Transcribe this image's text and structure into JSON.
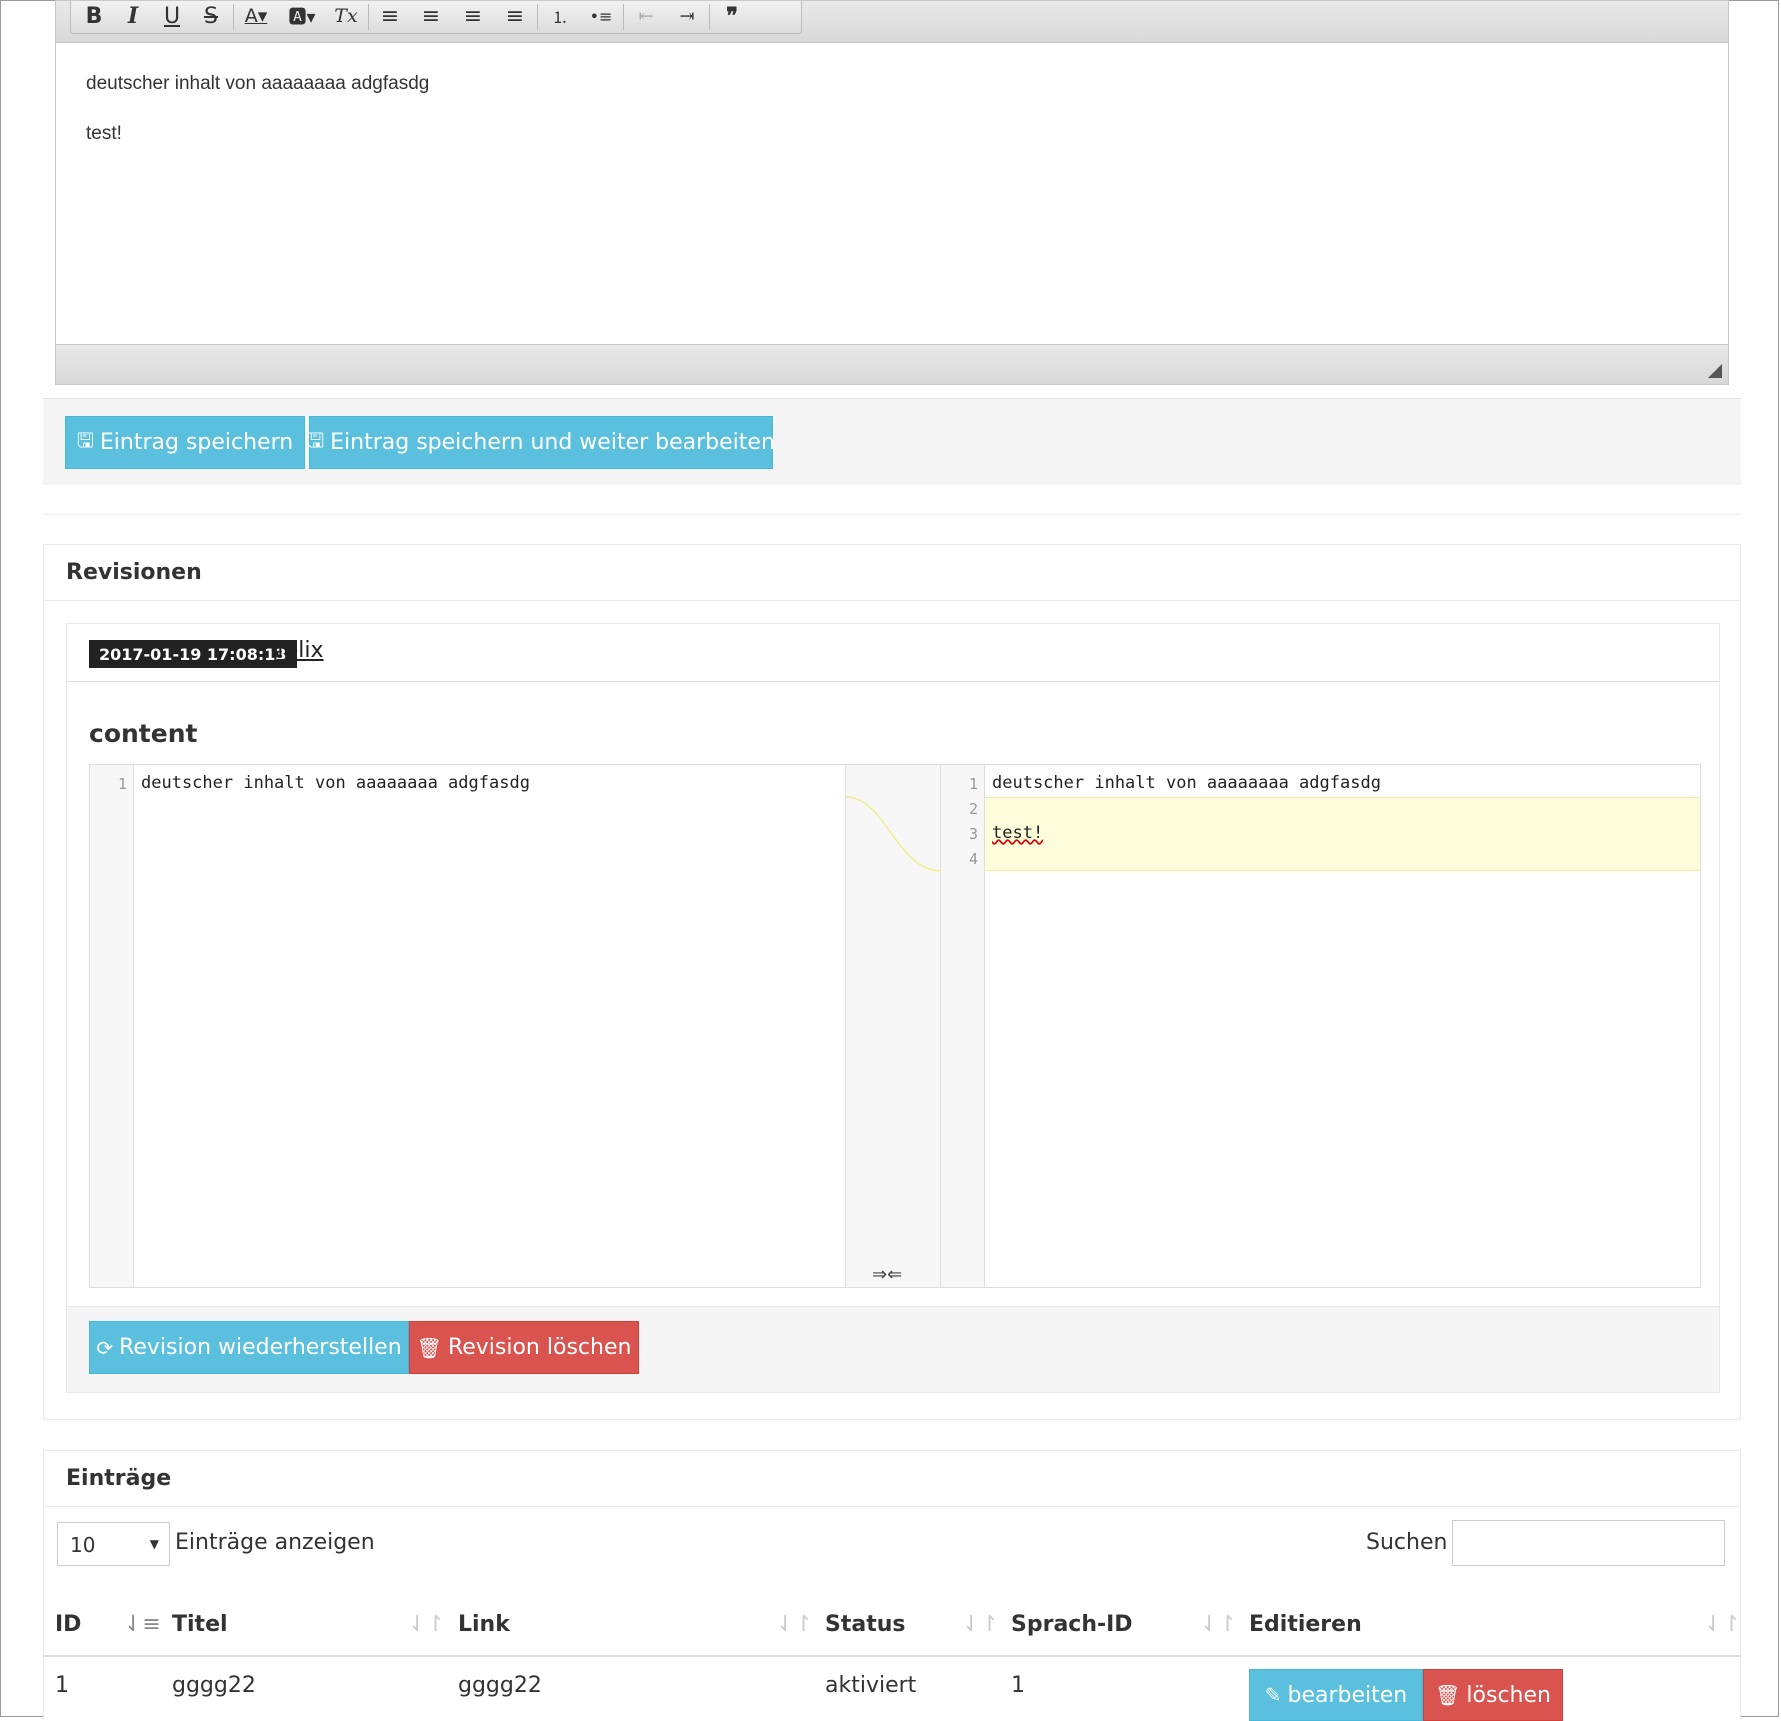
{
  "editor": {
    "toolbar": {
      "buttons": [
        {
          "icon": "bold-icon",
          "glyph": "B"
        },
        {
          "icon": "italic-icon",
          "glyph": "I"
        },
        {
          "icon": "underline-icon",
          "glyph": "U"
        },
        {
          "icon": "strikethrough-icon",
          "glyph": "S"
        },
        {
          "icon": "text-color-icon",
          "glyph": "A▾"
        },
        {
          "icon": "background-color-icon",
          "glyph": "🅰▾"
        },
        {
          "icon": "remove-format-icon",
          "glyph": "Tx"
        },
        {
          "icon": "align-left-icon",
          "glyph": "≡"
        },
        {
          "icon": "align-center-icon",
          "glyph": "≡"
        },
        {
          "icon": "align-right-icon",
          "glyph": "≡"
        },
        {
          "icon": "align-justify-icon",
          "glyph": "≡"
        },
        {
          "icon": "numbered-list-icon",
          "glyph": "⒈"
        },
        {
          "icon": "bulleted-list-icon",
          "glyph": "•≡"
        },
        {
          "icon": "outdent-icon",
          "glyph": "⇤"
        },
        {
          "icon": "indent-icon",
          "glyph": "⇥"
        },
        {
          "icon": "blockquote-icon",
          "glyph": "❞"
        }
      ]
    },
    "paragraphs": [
      "deutscher inhalt von aaaaaaaa adgfasdg",
      "test!"
    ]
  },
  "form_actions": {
    "save_label": "Eintrag speichern",
    "save_continue_label": "Eintrag speichern und weiter bearbeiten",
    "save_icon": "floppy-disk-icon"
  },
  "revisions": {
    "title": "Revisionen",
    "items": [
      {
        "timestamp": "2017-01-19 17:08:13",
        "user": "felix",
        "field": "content",
        "left": {
          "lines": [
            "deutscher inhalt von aaaaaaaa adgfasdg"
          ]
        },
        "right": {
          "lines": [
            "deutscher inhalt von aaaaaaaa adgfasdg",
            "",
            "test!",
            ""
          ]
        },
        "merge_toggle": "⇒⇐",
        "restore_label": "Revision wiederherstellen",
        "delete_label": "Revision löschen"
      }
    ]
  },
  "entries": {
    "title": "Einträge",
    "page_length": "10",
    "page_length_label": "Einträge anzeigen",
    "search_label": "Suchen",
    "search_value": "",
    "columns": [
      "ID",
      "Titel",
      "Link",
      "Status",
      "Sprach-ID",
      "Editieren"
    ],
    "sorted_column": "ID",
    "rows": [
      {
        "id": "1",
        "titel": "gggg22",
        "link": "gggg22",
        "status": "aktiviert",
        "sprach_id": "1"
      }
    ],
    "edit_label": "bearbeiten",
    "delete_label": "löschen"
  },
  "colors": {
    "info": "#5bc0de",
    "danger": "#d9534f",
    "diff_highlight": "#fdfddb"
  }
}
